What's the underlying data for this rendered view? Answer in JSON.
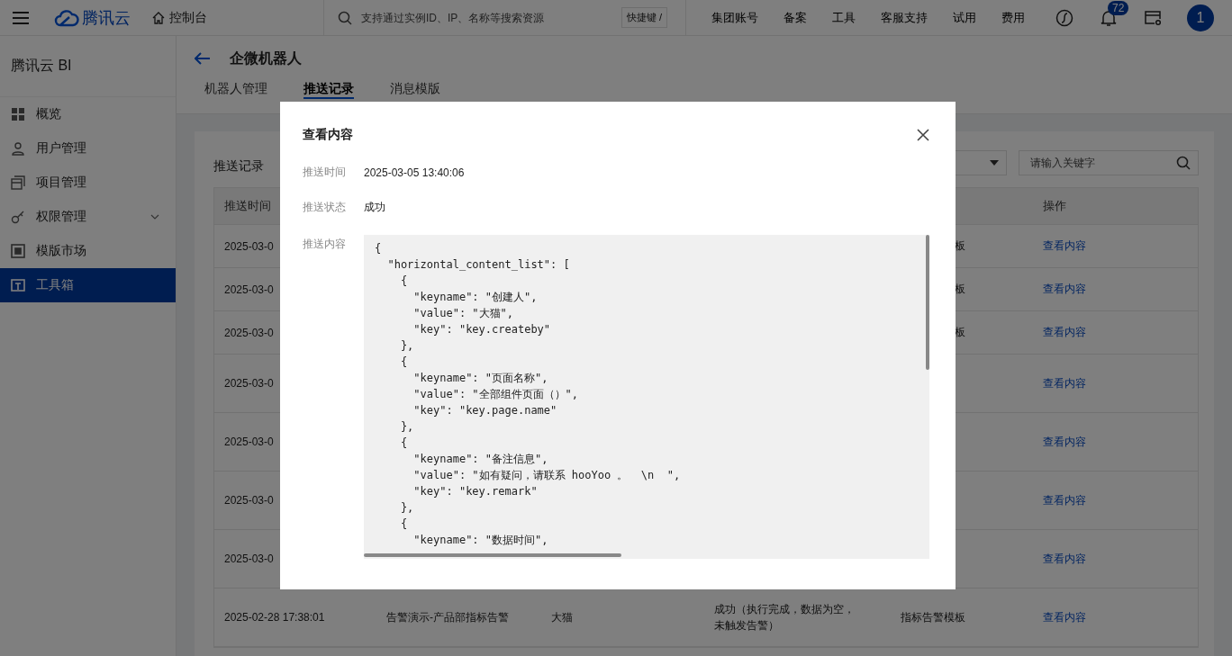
{
  "topbar": {
    "brand": "腾讯云",
    "console": "控制台",
    "search_placeholder": "支持通过实例ID、IP、名称等搜索资源",
    "shortcut": "快捷键 /",
    "nav": [
      "集团账号",
      "备案",
      "工具",
      "客服支持",
      "试用",
      "费用"
    ],
    "notification_count": "72",
    "avatar": "1"
  },
  "sidebar": {
    "title": "腾讯云 BI",
    "items": [
      {
        "label": "概览",
        "kind": "link",
        "selected": false
      },
      {
        "label": "用户管理",
        "kind": "link",
        "selected": false
      },
      {
        "label": "项目管理",
        "kind": "link",
        "selected": false
      },
      {
        "label": "权限管理",
        "kind": "group",
        "expanded": false,
        "selected": false
      },
      {
        "label": "模版市场",
        "kind": "link",
        "selected": false
      },
      {
        "label": "工具箱",
        "kind": "link",
        "selected": true
      }
    ]
  },
  "page": {
    "title": "企微机器人",
    "tabs": [
      {
        "label": "机器人管理",
        "selected": false
      },
      {
        "label": "推送记录",
        "selected": true
      },
      {
        "label": "消息模版",
        "selected": false
      }
    ]
  },
  "records": {
    "title": "推送记录",
    "search": {
      "placeholder": "请输入关键字"
    },
    "table": {
      "header": {
        "column_1": "推送时间",
        "column_6": "操作"
      },
      "rows": [
        {
          "column_1": "2025-03-0",
          "column_5": "板",
          "column_6": "查看内容"
        },
        {
          "column_1": "2025-03-0",
          "column_5": "板",
          "column_6": "查看内容"
        },
        {
          "column_1": "2025-03-0",
          "column_5": "板",
          "column_6": "查看内容"
        },
        {
          "column_1": "2025-03-0",
          "column_6": "查看内容"
        },
        {
          "column_1": "2025-03-0",
          "column_6": "查看内容"
        },
        {
          "column_1": "2025-03-0",
          "column_6": "查看内容"
        },
        {
          "column_1": "2025-03-0",
          "column_6": "查看内容"
        },
        {
          "column_1": "2025-02-28 17:38:01",
          "column_2": "告警演示-产品部指标告警",
          "column_3": "大猫",
          "column_4": "成功（执行完成，数据为空，未触发告警）",
          "column_5": "指标告警模板",
          "column_6": "查看内容"
        }
      ]
    }
  },
  "modal": {
    "title": "查看内容",
    "fields": [
      {
        "label": "推送时间",
        "value": "2025-03-05 13:40:06"
      },
      {
        "label": "推送状态",
        "value": "成功"
      }
    ],
    "content_label": "推送内容",
    "content_lines": [
      "{",
      "  \"horizontal_content_list\": [",
      "    {",
      "      \"keyname\": \"创建人\",",
      "      \"value\": \"大猫\",",
      "      \"key\": \"key.createby\"",
      "    },",
      "    {",
      "      \"keyname\": \"页面名称\",",
      "      \"value\": \"全部组件页面（）\",",
      "      \"key\": \"key.page.name\"",
      "    },",
      "    {",
      "      \"keyname\": \"备注信息\",",
      "      \"value\": \"如有疑问，请联系 hooYoo 。  \\n  \",",
      "      \"key\": \"key.remark\"",
      "    },",
      "    {",
      "      \"keyname\": \"数据时间\","
    ]
  }
}
